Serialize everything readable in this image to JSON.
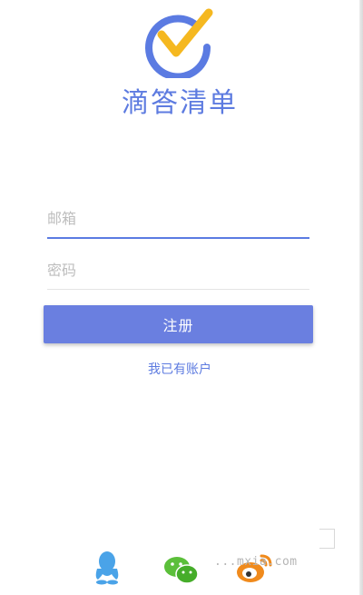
{
  "app": {
    "name": "滴答清单"
  },
  "form": {
    "email_placeholder": "邮箱",
    "password_placeholder": "密码",
    "register_label": "注册",
    "login_link": "我已有账户"
  },
  "social": {
    "icons": [
      "qq-icon",
      "wechat-icon",
      "weibo-icon"
    ]
  },
  "watermark": {
    "text": "...mxia.com"
  },
  "colors": {
    "accent": "#5b7be2",
    "button": "#6a7fe0",
    "check": "#f5b820"
  }
}
